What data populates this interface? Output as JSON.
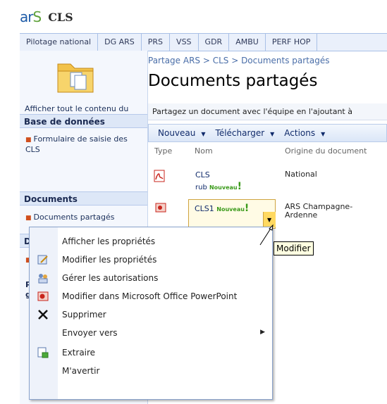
{
  "brand": {
    "logo_ar": "ar",
    "logo_s": "S",
    "site_title": "CLS"
  },
  "nav_tabs": [
    "Pilotage national",
    "DG ARS",
    "PRS",
    "VSS",
    "GDR",
    "AMBU",
    "PERF HOP"
  ],
  "breadcrumb": "Partage ARS > CLS > Documents partagés",
  "page_title": "Documents partagés",
  "sidebar": {
    "view_all": "Afficher tout le contenu du site",
    "section1": "Base de données",
    "item1": "Formulaire de saisie des CLS",
    "section2": "Documents",
    "item2": "Documents partagés",
    "section3_partial": "Di",
    "section4_partial1": "Pe",
    "section4_partial2": "gr"
  },
  "description": "Partagez un document avec l'équipe en l'ajoutant à",
  "toolbar": {
    "new": "Nouveau",
    "upload": "Télécharger",
    "actions": "Actions"
  },
  "columns": {
    "type": "Type",
    "name": "Nom",
    "origin": "Origine du document"
  },
  "rows": [
    {
      "name": "CLS",
      "sub": "rub",
      "badge": "Nouveau",
      "excl": "!",
      "origin": "National"
    },
    {
      "name": "CLS1",
      "badge": "Nouveau",
      "excl": "!",
      "origin": "ARS Champagne-Ardenne"
    }
  ],
  "menu": {
    "items": [
      "Afficher les propriétés",
      "Modifier les propriétés",
      "Gérer les autorisations",
      "Modifier dans Microsoft Office PowerPoint",
      "Supprimer",
      "Envoyer vers",
      "Extraire",
      "M'avertir"
    ],
    "submenu_arrow": "▶"
  },
  "tooltip": "Modifier",
  "icons": {
    "pdf": "pdf-icon",
    "ppt": "powerpoint-icon",
    "edit": "edit-properties-icon",
    "perm": "permissions-icon",
    "delete": "delete-icon",
    "checkout": "checkout-icon"
  },
  "colors": {
    "accent": "#4a6ea8",
    "nouveau": "#3a9a1a",
    "pdf_red": "#c8241c"
  }
}
